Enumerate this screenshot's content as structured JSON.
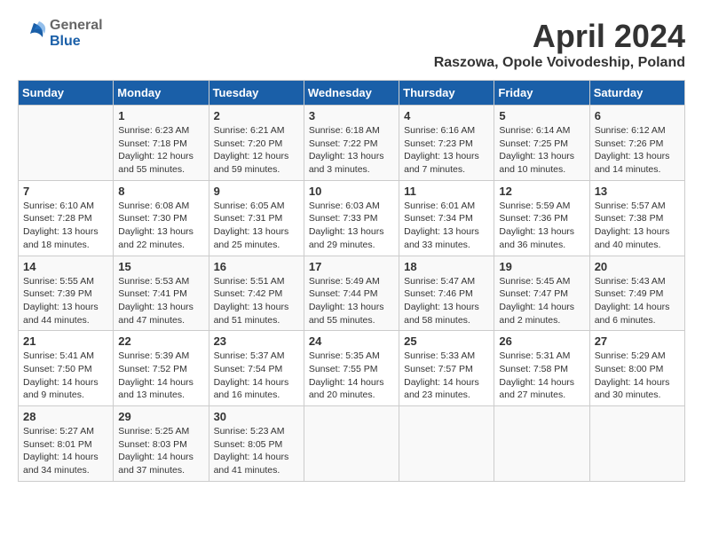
{
  "header": {
    "logo_general": "General",
    "logo_blue": "Blue",
    "month_year": "April 2024",
    "location": "Raszowa, Opole Voivodeship, Poland"
  },
  "days_of_week": [
    "Sunday",
    "Monday",
    "Tuesday",
    "Wednesday",
    "Thursday",
    "Friday",
    "Saturday"
  ],
  "weeks": [
    [
      {
        "day": "",
        "sunrise": "",
        "sunset": "",
        "daylight": ""
      },
      {
        "day": "1",
        "sunrise": "Sunrise: 6:23 AM",
        "sunset": "Sunset: 7:18 PM",
        "daylight": "Daylight: 12 hours and 55 minutes."
      },
      {
        "day": "2",
        "sunrise": "Sunrise: 6:21 AM",
        "sunset": "Sunset: 7:20 PM",
        "daylight": "Daylight: 12 hours and 59 minutes."
      },
      {
        "day": "3",
        "sunrise": "Sunrise: 6:18 AM",
        "sunset": "Sunset: 7:22 PM",
        "daylight": "Daylight: 13 hours and 3 minutes."
      },
      {
        "day": "4",
        "sunrise": "Sunrise: 6:16 AM",
        "sunset": "Sunset: 7:23 PM",
        "daylight": "Daylight: 13 hours and 7 minutes."
      },
      {
        "day": "5",
        "sunrise": "Sunrise: 6:14 AM",
        "sunset": "Sunset: 7:25 PM",
        "daylight": "Daylight: 13 hours and 10 minutes."
      },
      {
        "day": "6",
        "sunrise": "Sunrise: 6:12 AM",
        "sunset": "Sunset: 7:26 PM",
        "daylight": "Daylight: 13 hours and 14 minutes."
      }
    ],
    [
      {
        "day": "7",
        "sunrise": "Sunrise: 6:10 AM",
        "sunset": "Sunset: 7:28 PM",
        "daylight": "Daylight: 13 hours and 18 minutes."
      },
      {
        "day": "8",
        "sunrise": "Sunrise: 6:08 AM",
        "sunset": "Sunset: 7:30 PM",
        "daylight": "Daylight: 13 hours and 22 minutes."
      },
      {
        "day": "9",
        "sunrise": "Sunrise: 6:05 AM",
        "sunset": "Sunset: 7:31 PM",
        "daylight": "Daylight: 13 hours and 25 minutes."
      },
      {
        "day": "10",
        "sunrise": "Sunrise: 6:03 AM",
        "sunset": "Sunset: 7:33 PM",
        "daylight": "Daylight: 13 hours and 29 minutes."
      },
      {
        "day": "11",
        "sunrise": "Sunrise: 6:01 AM",
        "sunset": "Sunset: 7:34 PM",
        "daylight": "Daylight: 13 hours and 33 minutes."
      },
      {
        "day": "12",
        "sunrise": "Sunrise: 5:59 AM",
        "sunset": "Sunset: 7:36 PM",
        "daylight": "Daylight: 13 hours and 36 minutes."
      },
      {
        "day": "13",
        "sunrise": "Sunrise: 5:57 AM",
        "sunset": "Sunset: 7:38 PM",
        "daylight": "Daylight: 13 hours and 40 minutes."
      }
    ],
    [
      {
        "day": "14",
        "sunrise": "Sunrise: 5:55 AM",
        "sunset": "Sunset: 7:39 PM",
        "daylight": "Daylight: 13 hours and 44 minutes."
      },
      {
        "day": "15",
        "sunrise": "Sunrise: 5:53 AM",
        "sunset": "Sunset: 7:41 PM",
        "daylight": "Daylight: 13 hours and 47 minutes."
      },
      {
        "day": "16",
        "sunrise": "Sunrise: 5:51 AM",
        "sunset": "Sunset: 7:42 PM",
        "daylight": "Daylight: 13 hours and 51 minutes."
      },
      {
        "day": "17",
        "sunrise": "Sunrise: 5:49 AM",
        "sunset": "Sunset: 7:44 PM",
        "daylight": "Daylight: 13 hours and 55 minutes."
      },
      {
        "day": "18",
        "sunrise": "Sunrise: 5:47 AM",
        "sunset": "Sunset: 7:46 PM",
        "daylight": "Daylight: 13 hours and 58 minutes."
      },
      {
        "day": "19",
        "sunrise": "Sunrise: 5:45 AM",
        "sunset": "Sunset: 7:47 PM",
        "daylight": "Daylight: 14 hours and 2 minutes."
      },
      {
        "day": "20",
        "sunrise": "Sunrise: 5:43 AM",
        "sunset": "Sunset: 7:49 PM",
        "daylight": "Daylight: 14 hours and 6 minutes."
      }
    ],
    [
      {
        "day": "21",
        "sunrise": "Sunrise: 5:41 AM",
        "sunset": "Sunset: 7:50 PM",
        "daylight": "Daylight: 14 hours and 9 minutes."
      },
      {
        "day": "22",
        "sunrise": "Sunrise: 5:39 AM",
        "sunset": "Sunset: 7:52 PM",
        "daylight": "Daylight: 14 hours and 13 minutes."
      },
      {
        "day": "23",
        "sunrise": "Sunrise: 5:37 AM",
        "sunset": "Sunset: 7:54 PM",
        "daylight": "Daylight: 14 hours and 16 minutes."
      },
      {
        "day": "24",
        "sunrise": "Sunrise: 5:35 AM",
        "sunset": "Sunset: 7:55 PM",
        "daylight": "Daylight: 14 hours and 20 minutes."
      },
      {
        "day": "25",
        "sunrise": "Sunrise: 5:33 AM",
        "sunset": "Sunset: 7:57 PM",
        "daylight": "Daylight: 14 hours and 23 minutes."
      },
      {
        "day": "26",
        "sunrise": "Sunrise: 5:31 AM",
        "sunset": "Sunset: 7:58 PM",
        "daylight": "Daylight: 14 hours and 27 minutes."
      },
      {
        "day": "27",
        "sunrise": "Sunrise: 5:29 AM",
        "sunset": "Sunset: 8:00 PM",
        "daylight": "Daylight: 14 hours and 30 minutes."
      }
    ],
    [
      {
        "day": "28",
        "sunrise": "Sunrise: 5:27 AM",
        "sunset": "Sunset: 8:01 PM",
        "daylight": "Daylight: 14 hours and 34 minutes."
      },
      {
        "day": "29",
        "sunrise": "Sunrise: 5:25 AM",
        "sunset": "Sunset: 8:03 PM",
        "daylight": "Daylight: 14 hours and 37 minutes."
      },
      {
        "day": "30",
        "sunrise": "Sunrise: 5:23 AM",
        "sunset": "Sunset: 8:05 PM",
        "daylight": "Daylight: 14 hours and 41 minutes."
      },
      {
        "day": "",
        "sunrise": "",
        "sunset": "",
        "daylight": ""
      },
      {
        "day": "",
        "sunrise": "",
        "sunset": "",
        "daylight": ""
      },
      {
        "day": "",
        "sunrise": "",
        "sunset": "",
        "daylight": ""
      },
      {
        "day": "",
        "sunrise": "",
        "sunset": "",
        "daylight": ""
      }
    ]
  ]
}
